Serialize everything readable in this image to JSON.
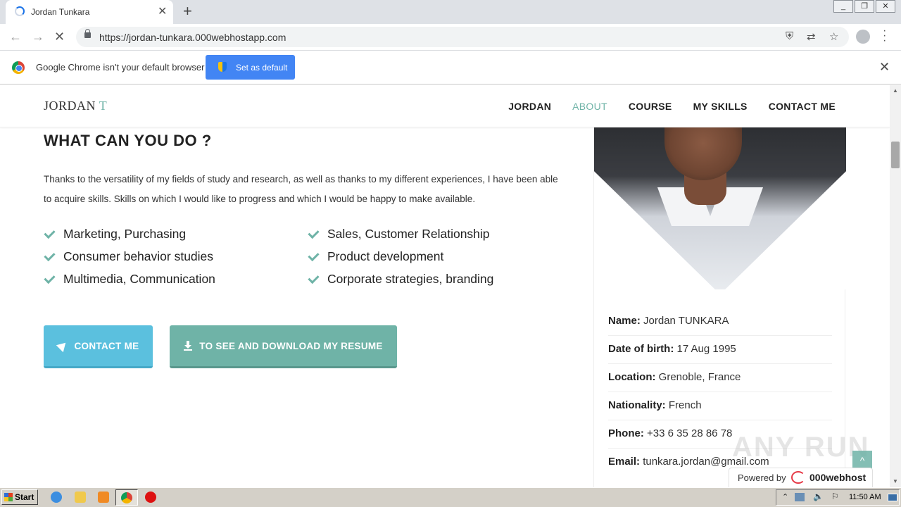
{
  "browser": {
    "tab_title": "Jordan Tunkara",
    "url": "https://jordan-tunkara.000webhostapp.com",
    "new_tab_symbol": "+",
    "close_symbol": "✕",
    "infobar_text": "Google Chrome isn't your default browser",
    "set_default_label": "Set as default"
  },
  "site": {
    "brand": "JORDAN",
    "brand_initial": "T",
    "nav": [
      "JORDAN",
      "ABOUT",
      "COURSE",
      "MY SKILLS",
      "CONTACT ME"
    ],
    "active_nav": "ABOUT",
    "heading": "WHAT CAN YOU DO ?",
    "intro": "Thanks to the versatility of my fields of study and research, as well as thanks to my different experiences, I have been able to acquire skills. Skills on which I would like to progress and which I would be happy to make available.",
    "skills": [
      "Marketing, Purchasing",
      "Sales, Customer Relationship",
      "Consumer behavior studies",
      "Product development",
      "Multimedia, Communication",
      "Corporate strategies, branding"
    ],
    "contact_button": "CONTACT ME",
    "resume_button": "TO SEE AND DOWNLOAD MY RESUME",
    "profile": [
      {
        "key": "Name:",
        "value": "Jordan TUNKARA"
      },
      {
        "key": "Date of birth:",
        "value": "17 Aug 1995"
      },
      {
        "key": "Location:",
        "value": "Grenoble, France"
      },
      {
        "key": "Nationality:",
        "value": "French"
      },
      {
        "key": "Phone:",
        "value": "+33 6 35 28 86 78"
      },
      {
        "key": "Email:",
        "value": "tunkara.jordan@gmail.com"
      }
    ],
    "powered_by": "Powered by",
    "host_name": "000webhost",
    "watermark": "ANY RUN"
  },
  "taskbar": {
    "start_label": "Start",
    "clock": "11:50 AM"
  },
  "colors": {
    "accent": "#6fb3a7",
    "contact_button": "#5bc0de",
    "chrome_blue": "#4285f4"
  }
}
